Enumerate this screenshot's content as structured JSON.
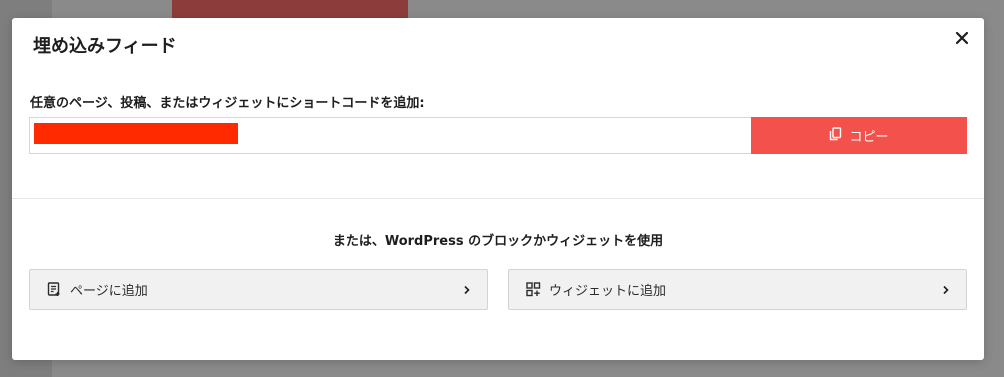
{
  "modal": {
    "title": "埋め込みフィード",
    "close_icon": "close-icon"
  },
  "shortcode": {
    "label": "任意のページ、投稿、またはウィジェットにショートコードを追加:",
    "value": "",
    "copy_label": "コピー",
    "copy_icon": "copy-icon"
  },
  "alternatives": {
    "heading": "または、WordPress のブロックかウィジェットを使用",
    "buttons": [
      {
        "label": "ページに追加",
        "icon": "page-add-icon"
      },
      {
        "label": "ウィジェットに追加",
        "icon": "widget-add-icon"
      }
    ]
  },
  "colors": {
    "accent": "#f3514b",
    "redaction": "#ff2a00"
  }
}
